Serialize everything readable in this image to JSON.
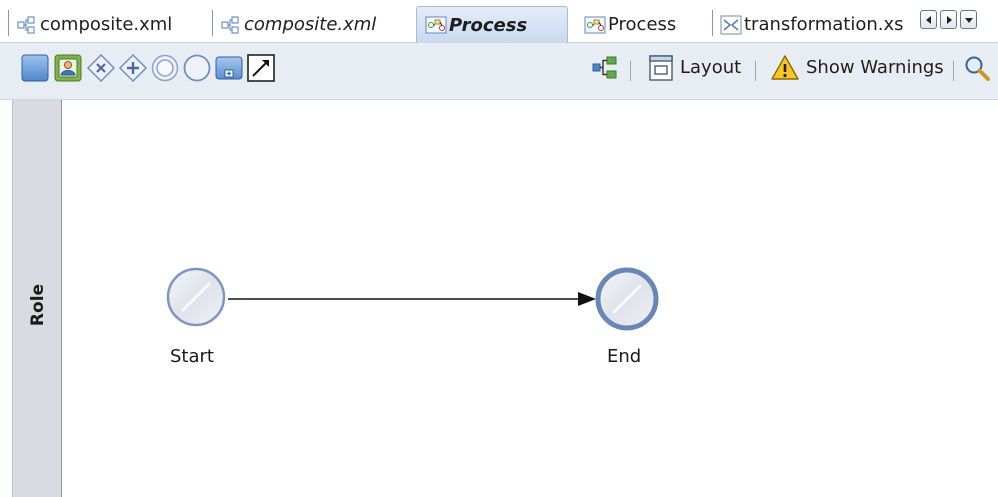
{
  "tabs": [
    {
      "label": "composite.xml",
      "style": "normal",
      "active": false,
      "icon": "composite-icon"
    },
    {
      "label": "composite.xml",
      "style": "italic",
      "active": false,
      "icon": "composite-icon"
    },
    {
      "label": "Process",
      "style": "bolditalic",
      "active": true,
      "icon": "process-icon"
    },
    {
      "label": "Process",
      "style": "normal",
      "active": false,
      "icon": "process-icon"
    },
    {
      "label": "transformation.xs",
      "style": "normal",
      "active": false,
      "icon": "transformation-icon"
    }
  ],
  "tab_nav": [
    "scroll-left-icon",
    "scroll-right-icon",
    "tab-list-icon"
  ],
  "toolbar": {
    "tools": [
      "swimlane-icon",
      "role-icon",
      "exclusive-gateway-icon",
      "parallel-gateway-icon",
      "end-event-icon",
      "start-event-icon",
      "subprocess-icon",
      "connector-icon"
    ],
    "layout_label": "Layout",
    "show_warnings_label": "Show Warnings"
  },
  "canvas": {
    "lane": "Role",
    "start_label": "Start",
    "end_label": "End"
  },
  "colors": {
    "tab_active": "#c8d9ee",
    "toolbar_bg": "#e8edf4",
    "lane_header": "#d9dbe2",
    "event_stroke": "#6f8fc0",
    "event_fill": "#e6e9ee"
  }
}
